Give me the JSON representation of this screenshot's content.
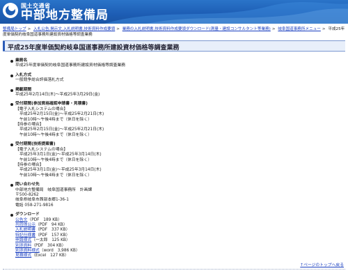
{
  "header": {
    "ministry": "国土交通省",
    "bureau": "中部地方整備局"
  },
  "breadcrumb": [
    {
      "label": "整備局トップ",
      "link": true
    },
    {
      "label": "入札公告,掲示文,入札説明書,技術資料作成要領",
      "link": true
    },
    {
      "label": "業務の入札説明書,技術資料作成要領ダウンロード(測量・建設コンサルタント等業務)",
      "link": true
    },
    {
      "label": "岐阜国道事務所メニュー",
      "link": true
    },
    {
      "label": "平成25年度単価契約岐阜国道事務所建設資材価格等調査業務",
      "link": false
    }
  ],
  "title": "平成25年度単価契約岐阜国道事務所建設資材価格等調査業務",
  "sections": {
    "name": {
      "head": "業務名",
      "lines": [
        "平成25年度単価契約岐阜国道事務所建設資材価格等調査業務"
      ]
    },
    "method": {
      "head": "入札方式",
      "lines": [
        "一般競争総合評価落札方式"
      ]
    },
    "period": {
      "head": "掲載期間",
      "lines": [
        "平成25年2月14日(木)〜平成25年3月29日(金)"
      ]
    },
    "accept1": {
      "head": "受付期間(参加資格確認申請書・見積書)",
      "lines": [
        "【電子入札システムの場合】",
        "平成25年2月15日(金)〜平成25年2月21日(木)",
        "午前10時〜午後4時まで（休日を除く）",
        "【持参の場合】",
        "平成25年2月15日(金)〜平成25年2月21日(木)",
        "午前10時〜午後4時まで（休日を除く）"
      ]
    },
    "accept2": {
      "head": "受付期間(技術提案書)",
      "lines": [
        "【電子入札システムの場合】",
        "平成25年3月1日(金)〜平成25年3月14日(木)",
        "午前10時〜午後4時まで（休日を除く）",
        "【持参の場合】",
        "平成25年3月1日(金)〜平成25年3月14日(木)",
        "午前10時〜午後4時まで（休日を除く）"
      ]
    },
    "contact": {
      "head": "問い合わせ先",
      "lines": [
        "中部地方整備局　岐阜国道事務所　計画課",
        "〒500-8262",
        "岐阜県岐阜市茜部本郷1-36-1",
        "電話 058-271-9816"
      ]
    },
    "download": {
      "head": "ダウンロード",
      "files": [
        {
          "name": "公告文",
          "info": "（PDF　189 KB）"
        },
        {
          "name": "共同体公示",
          "info": "（PDF　94 KB）"
        },
        {
          "name": "入札説明書",
          "info": "（PDF　337 KB）"
        },
        {
          "name": "特記仕様書",
          "info": "（PDF　157 KB）"
        },
        {
          "name": "申請様式",
          "info": "（一太郎　125 KB）"
        },
        {
          "name": "別添資料",
          "info": "（PDF　304 KB）"
        },
        {
          "name": "別添資料様式",
          "info": "（word　3,986 KB）"
        },
        {
          "name": "見積様式",
          "info": "（Excel　127 KB）"
        }
      ]
    }
  },
  "footer": {
    "pagetop": "↑ページのトップへ戻る"
  },
  "colors": {
    "header_blue": "#1d5db4",
    "link": "#1a3fc0",
    "title_bg": "#e8effa"
  }
}
